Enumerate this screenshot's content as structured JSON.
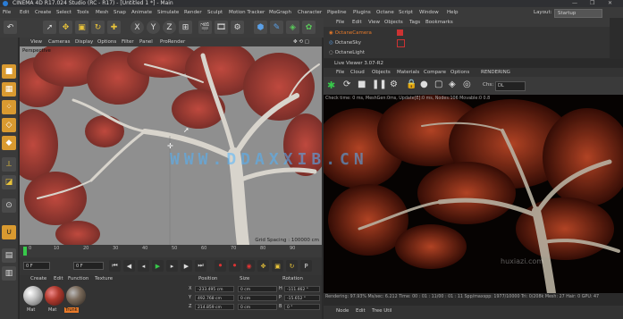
{
  "window": {
    "title": "CINEMA 4D R17.024 Studio (RC - R17) - [Untitled 1 *] - Main",
    "controls": [
      "—",
      "❐",
      "✕"
    ]
  },
  "menubar": {
    "items": [
      "File",
      "Edit",
      "Create",
      "Select",
      "Tools",
      "Mesh",
      "Snap",
      "Animate",
      "Simulate",
      "Render",
      "Sculpt",
      "Motion Tracker",
      "MoGraph",
      "Character",
      "Pipeline",
      "Plugins",
      "Octane",
      "Script",
      "Window",
      "Help"
    ],
    "layout_label": "Layout:",
    "layout_value": "Startup"
  },
  "toolbar": {
    "axis_x": "X",
    "axis_y": "Y",
    "axis_z": "Z"
  },
  "viewport": {
    "menu": [
      "View",
      "Cameras",
      "Display",
      "Options",
      "Filter",
      "Panel",
      "ProRender"
    ],
    "label": "Perspective",
    "grid_spacing": "Grid Spacing : 100000 cm"
  },
  "timeline": {
    "ticks": [
      "0",
      "10",
      "20",
      "30",
      "40",
      "50",
      "60",
      "70",
      "80",
      "90"
    ],
    "start_frame": "0 F",
    "current_frame": "0 F",
    "end_frame": "90 F",
    "max_frame": "90 F"
  },
  "material_manager": {
    "menu": [
      "Create",
      "Edit",
      "Function",
      "Texture"
    ],
    "materials": [
      {
        "name": "Mat",
        "color": "#c0c0c0"
      },
      {
        "name": "Mat",
        "color": "#b03a2e"
      },
      {
        "name": "Trunk",
        "color": "#7a6a5a"
      }
    ]
  },
  "coordinates": {
    "headers": [
      "Position",
      "Size",
      "Rotation"
    ],
    "rows": [
      {
        "axis": "X",
        "pos": "-233.495 cm",
        "size": "0 cm",
        "rot_label": "H",
        "rot": "-111.462 °"
      },
      {
        "axis": "Y",
        "pos": "492.768 cm",
        "size": "0 cm",
        "rot_label": "P",
        "rot": "-15.652 °"
      },
      {
        "axis": "Z",
        "pos": "214.859 cm",
        "size": "0 cm",
        "rot_label": "B",
        "rot": "0 °"
      }
    ]
  },
  "object_manager": {
    "menu": [
      "File",
      "Edit",
      "View",
      "Objects",
      "Tags",
      "Bookmarks"
    ],
    "objects": [
      {
        "name": "OctaneCamera",
        "color": "#e87a2a"
      },
      {
        "name": "OctaneSky",
        "color": "#aaaaaa"
      },
      {
        "name": "OctaneLight",
        "color": "#aaaaaa"
      }
    ]
  },
  "picture_viewer": {
    "title": "Live Viewer 3.07-R2",
    "menu": [
      "File",
      "Cloud",
      "Objects",
      "Materials",
      "Compare",
      "Options",
      "RENDERING"
    ],
    "channel_label": "Chs:",
    "channel_value": "DL",
    "info": "Check time: 0 ms, MeshGen:0ms, Update[E]:0 ms, Nodes:106 Movable:0 0.8",
    "status": "Rendering: 97.93%  Ms/sec: 6.212  Time: 00 : 01 : 11/00 : 01 : 11  Spp/maxspp: 1977/10000  Tri: 0/208k  Mesh: 27  Hair: 0  GPU: 47",
    "bottom_menu": [
      "Node",
      "Edit",
      "Tree Util"
    ],
    "watermark_text": "huxiazi.com"
  },
  "overlay": {
    "watermark": "WWW.DDAXXIB.CN"
  },
  "colors": {
    "accent_orange": "#e87a2a",
    "play_green": "#37c94a",
    "leaf_red": "#b53a30"
  }
}
